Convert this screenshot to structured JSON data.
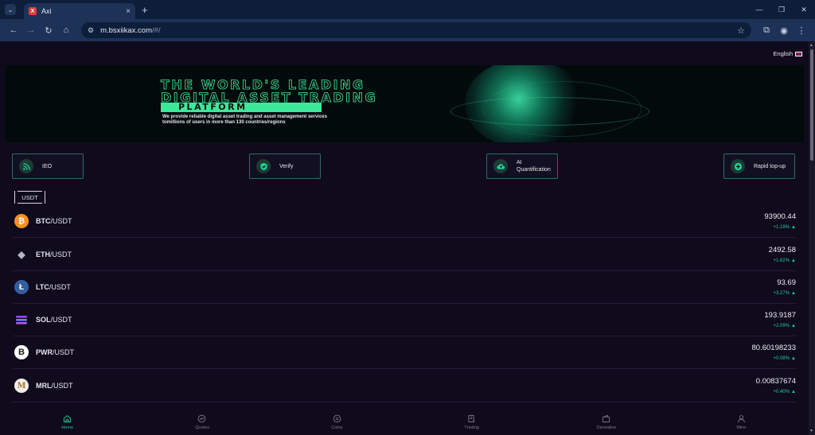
{
  "browser": {
    "tab_title": "Axi",
    "favicon_letter": "X",
    "url_host": "m.bsxiikax.com",
    "url_path": "/#/",
    "new_tab": "+",
    "close_tab": "×"
  },
  "header": {
    "language": "English"
  },
  "banner": {
    "line1": "THE WORLD'S LEADING",
    "line2": "DIGITAL ASSET TRADING",
    "platform": "PLATFORM",
    "sub1": "We provide reliable digital asset trading and asset management services",
    "sub2": "tomillions  of  users in more than 130 countries/regions"
  },
  "shortcuts": [
    {
      "label": "IEO",
      "icon": "rss-icon"
    },
    {
      "label": "Verify",
      "icon": "shield-check-icon"
    },
    {
      "label": "AI\nQuantification",
      "icon": "cloud-upload-icon"
    },
    {
      "label": "Rapid top-up",
      "icon": "plus-circle-icon"
    }
  ],
  "market_tab": "USDT",
  "markets": [
    {
      "base": "BTC",
      "quote": "/USDT",
      "price": "93900.44",
      "change": "+1.19%",
      "color": "#f7931a",
      "symbol": "₿"
    },
    {
      "base": "ETH",
      "quote": "/USDT",
      "price": "2492.58",
      "change": "+1.62%",
      "color": "#0f0a1c",
      "symbol": "◆"
    },
    {
      "base": "LTC",
      "quote": "/USDT",
      "price": "93.69",
      "change": "+3.27%",
      "color": "#345d9d",
      "symbol": "Ł"
    },
    {
      "base": "SOL",
      "quote": "/USDT",
      "price": "193.9187",
      "change": "+2.09%",
      "color": "#0f0a1c",
      "symbol": "≡"
    },
    {
      "base": "PWR",
      "quote": "/USDT",
      "price": "80.60198233",
      "change": "+0.08%",
      "color": "#ffffff",
      "symbol": "B"
    },
    {
      "base": "MRL",
      "quote": "/USDT",
      "price": "0.00837674",
      "change": "+0.40%",
      "color": "#f3efe6",
      "symbol": "M"
    }
  ],
  "bottom_nav": [
    {
      "label": "Home",
      "icon": "home-icon"
    },
    {
      "label": "Quotes",
      "icon": "chart-icon"
    },
    {
      "label": "Coins",
      "icon": "coin-icon"
    },
    {
      "label": "Trading",
      "icon": "trading-icon"
    },
    {
      "label": "Derivative",
      "icon": "wallet-icon"
    },
    {
      "label": "Mine",
      "icon": "user-icon"
    }
  ],
  "colors": {
    "accent": "#1fcf94",
    "background": "#0f0a1c",
    "border": "#2a6f64"
  }
}
